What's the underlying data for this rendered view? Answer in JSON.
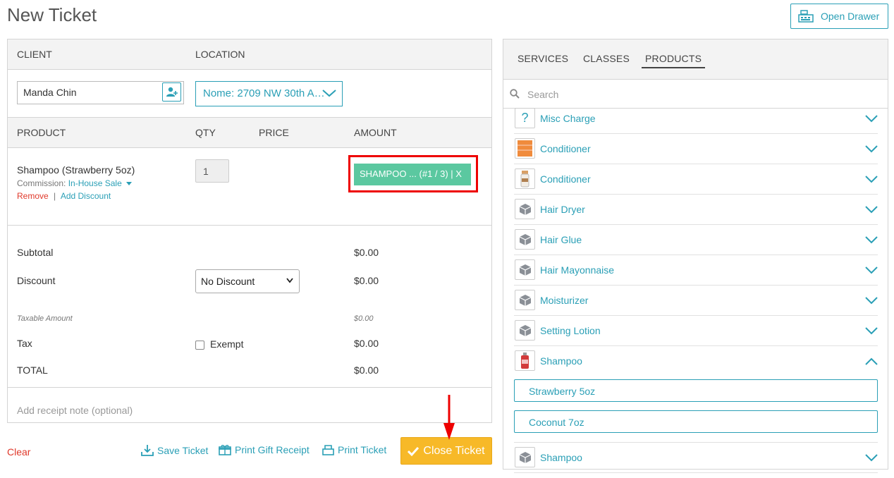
{
  "page": {
    "title": "New Ticket",
    "open_drawer_label": "Open Drawer"
  },
  "client_section": {
    "client_header": "CLIENT",
    "location_header": "LOCATION",
    "client_value": "Manda Chin",
    "location_value": "Nome: 2709 NW 30th A…"
  },
  "product_table": {
    "headers": {
      "product": "PRODUCT",
      "qty": "QTY",
      "price": "PRICE",
      "amount": "AMOUNT"
    },
    "rows": [
      {
        "name": "Shampoo (Strawberry 5oz)",
        "commission_label": "Commission:",
        "commission_value": "In-House Sale",
        "remove_label": "Remove",
        "separator": "|",
        "add_discount_label": "Add Discount",
        "qty": "1",
        "tag": "SHAMPOO ... (#1 / 3) | X"
      }
    ]
  },
  "totals": {
    "subtotal_label": "Subtotal",
    "subtotal_value": "$0.00",
    "discount_label": "Discount",
    "discount_select": "No Discount",
    "discount_value": "$0.00",
    "taxable_label": "Taxable Amount",
    "taxable_value": "$0.00",
    "tax_label": "Tax",
    "exempt_label": "Exempt",
    "tax_value": "$0.00",
    "total_label": "TOTAL",
    "total_value": "$0.00"
  },
  "receipt_note_placeholder": "Add receipt note (optional)",
  "actions": {
    "clear": "Clear",
    "save_ticket": "Save Ticket",
    "print_gift_receipt": "Print Gift Receipt",
    "print_ticket": "Print Ticket",
    "close_ticket": "Close Ticket"
  },
  "catalog": {
    "tabs": [
      {
        "label": "SERVICES",
        "active": false
      },
      {
        "label": "CLASSES",
        "active": false
      },
      {
        "label": "PRODUCTS",
        "active": true
      }
    ],
    "search_placeholder": "Search",
    "items": [
      {
        "name": "Misc Charge",
        "icon": "question-icon",
        "expanded": false
      },
      {
        "name": "Conditioner",
        "icon": "product-photo-orange",
        "expanded": false
      },
      {
        "name": "Conditioner",
        "icon": "product-photo-bottle",
        "expanded": false
      },
      {
        "name": "Hair Dryer",
        "icon": "box-icon",
        "expanded": false
      },
      {
        "name": "Hair Glue",
        "icon": "box-icon",
        "expanded": false
      },
      {
        "name": "Hair Mayonnaise",
        "icon": "box-icon",
        "expanded": false
      },
      {
        "name": "Moisturizer",
        "icon": "box-icon",
        "expanded": false
      },
      {
        "name": "Setting Lotion",
        "icon": "box-icon",
        "expanded": false
      },
      {
        "name": "Shampoo",
        "icon": "product-photo-red",
        "expanded": true
      },
      {
        "name": "Shampoo",
        "icon": "box-icon",
        "expanded": false
      }
    ],
    "variants": [
      "Strawberry 5oz",
      "Coconut 7oz"
    ]
  },
  "colors": {
    "accent": "#2a9fb6",
    "success_tag": "#5bc8a0",
    "close_button": "#f7b928",
    "danger": "#e0392b"
  }
}
